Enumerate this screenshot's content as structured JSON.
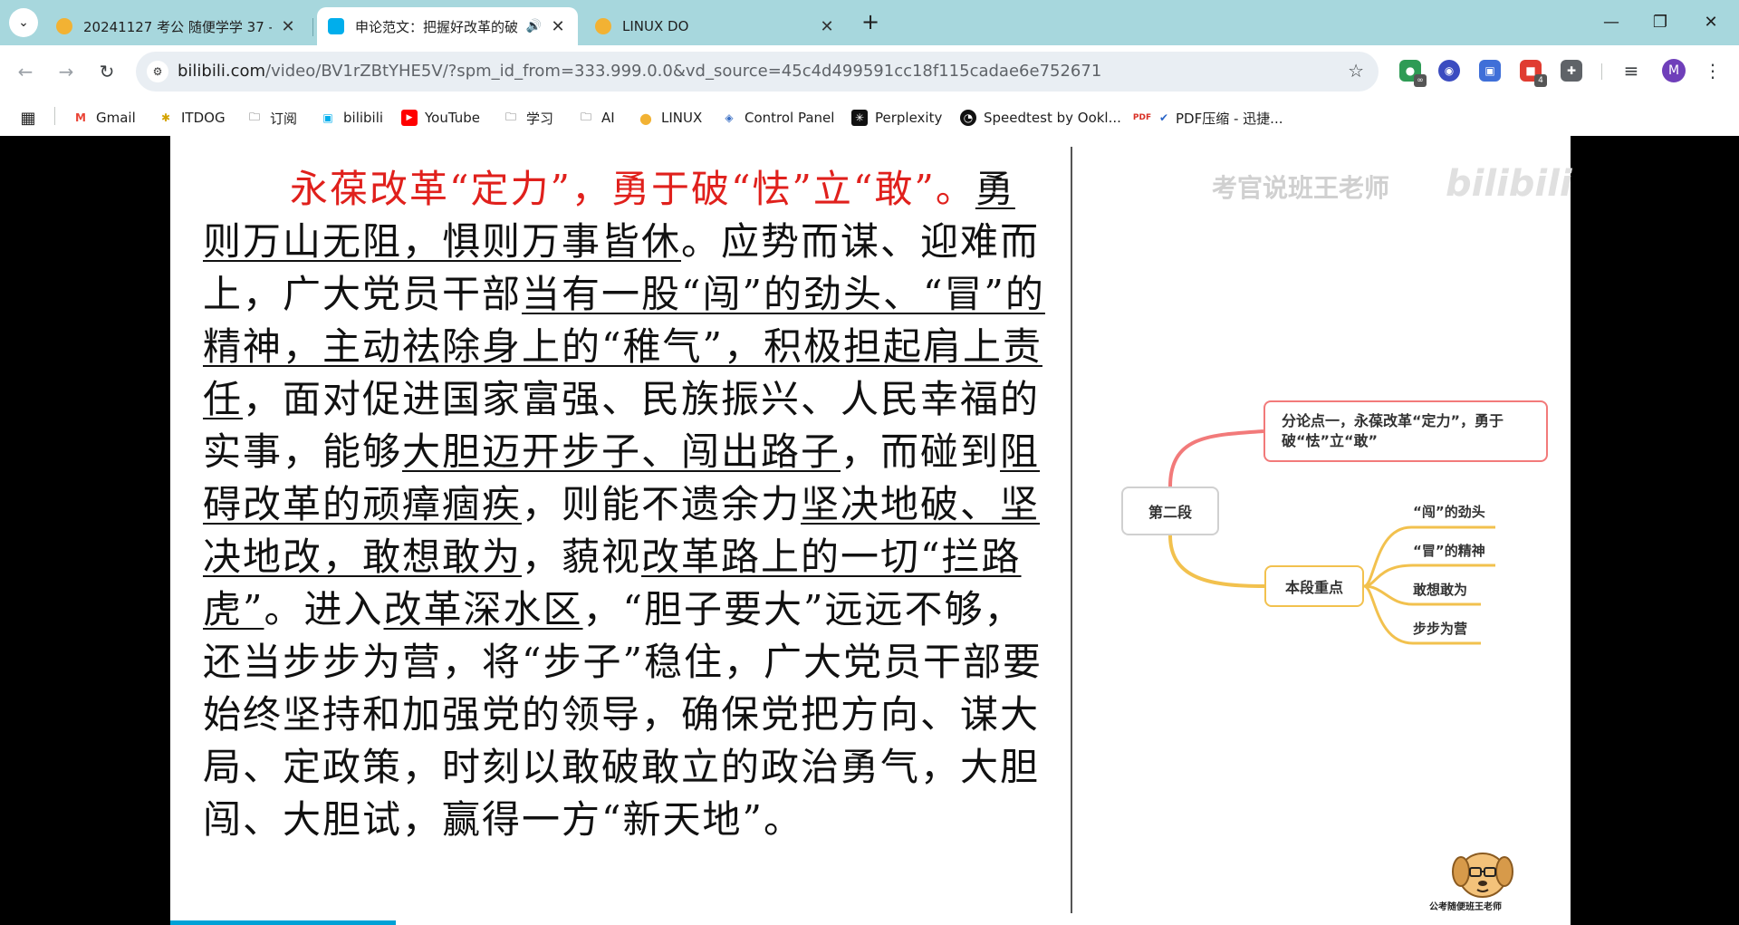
{
  "tabs": [
    {
      "title": "20241127 考公 随便学学 37 -",
      "favicon_color": "#f2b233",
      "active": false
    },
    {
      "title": "申论范文：把握好改革的破",
      "favicon_color": "#00aeec",
      "active": true,
      "audio": "🔊"
    },
    {
      "title": "LINUX DO",
      "favicon_color": "#f2b233",
      "active": false
    }
  ],
  "tab_close_glyph": "✕",
  "newtab_glyph": "+",
  "window": {
    "minimize": "—",
    "restore": "❐",
    "close": "✕"
  },
  "nav": {
    "back": "←",
    "forward": "→",
    "reload": "↻"
  },
  "omnibox": {
    "host": "bilibili.com",
    "path": "/video/BV1rZBtYHE5V/?spm_id_from=333.999.0.0&vd_source=45c4d499591cc18f115cadae6e752671",
    "star": "☆",
    "site_icon": "⚙"
  },
  "extensions": [
    {
      "name": "chat-extension",
      "glyph": "●",
      "color": "#2e9b55",
      "badge": "∞"
    },
    {
      "name": "robot-extension",
      "glyph": "◉",
      "color": "#3b4cc0",
      "badge": ""
    },
    {
      "name": "square-extension",
      "glyph": "▣",
      "color": "#3f6fd8",
      "badge": ""
    },
    {
      "name": "red-extension",
      "glyph": "■",
      "color": "#e03c31",
      "badge": "4"
    },
    {
      "name": "puzzle-extension",
      "glyph": "✚",
      "color": "#5f6368",
      "badge": ""
    }
  ],
  "media_glyph": "≡",
  "menu_glyph": "⋮",
  "avatar": "M",
  "bookmarks": [
    {
      "label": "",
      "icon": "apps-icon",
      "glyph": "▦",
      "color": "#333"
    },
    {
      "label": "Gmail",
      "icon": "gmail-icon",
      "glyph": "M",
      "color": "#ea4335"
    },
    {
      "label": "ITDOG",
      "icon": "itdog-icon",
      "glyph": "✱",
      "color": "#d4a300"
    },
    {
      "label": "订阅",
      "icon": "folder-icon",
      "glyph": "🗀",
      "color": "#444"
    },
    {
      "label": "bilibili",
      "icon": "bilibili-icon",
      "glyph": "▣",
      "color": "#00aeec"
    },
    {
      "label": "YouTube",
      "icon": "youtube-icon",
      "glyph": "▶",
      "color": "#ff0000"
    },
    {
      "label": "学习",
      "icon": "folder-icon",
      "glyph": "🗀",
      "color": "#444"
    },
    {
      "label": "AI",
      "icon": "folder-icon",
      "glyph": "🗀",
      "color": "#444"
    },
    {
      "label": "LINUX",
      "icon": "linux-do-icon",
      "glyph": "●",
      "color": "#f2b233"
    },
    {
      "label": "Control Panel",
      "icon": "control-panel-icon",
      "glyph": "◈",
      "color": "#3a6fc4"
    },
    {
      "label": "Perplexity",
      "icon": "perplexity-icon",
      "glyph": "✳",
      "color": "#111"
    },
    {
      "label": "Speedtest by Ookl...",
      "icon": "speedtest-icon",
      "glyph": "◔",
      "color": "#111"
    },
    {
      "label": "PDF压缩 - 迅捷...",
      "icon": "pdf-icon",
      "glyph": "✔",
      "color": "#2a65c8"
    }
  ],
  "essay": {
    "heading_red": "永葆改革“定力”，勇于破“怯”立“敢”。",
    "p1u": "勇则万山无阻，惧则万事皆休",
    "p2": "。应势而谋、迎难而上，广大党员干部",
    "p3u": "当有一股“闯”的劲头、“冒”的精神，主动祛除身上的“稚气”，积极担起肩上责任",
    "p4": "，面对促进国家富强、民族振兴、人民幸福的实事，能够",
    "p5u": "大胆迈开步子、闯出路子",
    "p6": "，而碰到",
    "p7u": "阻碍改革的顽瘴痼疾",
    "p8": "，则能不遗余力",
    "p9u": "坚决地破、坚决地改，敢想敢为",
    "p10": "，藐视",
    "p11u": "改革路上的一切“拦路虎”",
    "p12": "。进入",
    "p13u": "改革深水区",
    "p14": "，“胆子要大”远远不够，还当步步为营，将“步子”稳住，广大党员干部要始终坚持和加强党的领导，确保党把方向、谋大局、定政策，时刻以敢破敢立的政治勇气，大胆闯、大胆试，赢得一方“新天地”。"
  },
  "watermark": {
    "text": "考官说班王老师",
    "logo": "bilibili"
  },
  "mindmap": {
    "root": "第二段",
    "topic1": "分论点一，永葆改革“定力”，勇于破“怯”立“敢”",
    "topic2": "本段重点",
    "leaves": [
      "“闯”的劲头",
      "“冒”的精神",
      "敢想敢为",
      "步步为营"
    ],
    "colors": {
      "topic1": "#f27a7a",
      "topic2": "#f2c14e"
    }
  },
  "mascot_caption": "公考随便班王老师",
  "progress_fraction": 0.161
}
